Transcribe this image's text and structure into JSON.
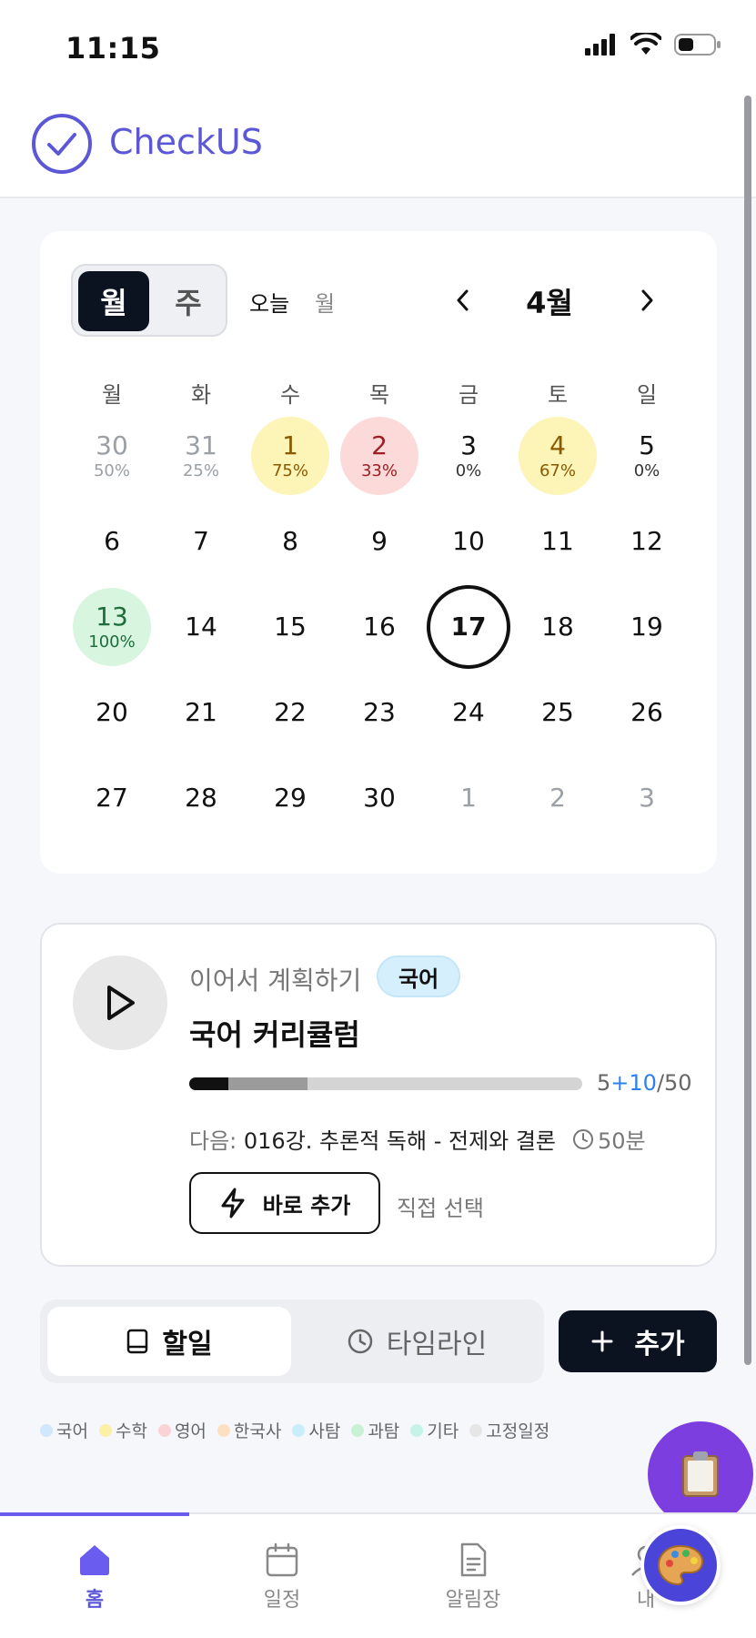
{
  "status_bar": {
    "time": "11:15"
  },
  "header": {
    "app_name": "CheckUS"
  },
  "calendar": {
    "view_toggle": {
      "month": "월",
      "week": "주"
    },
    "today_label": "오늘",
    "today_month_short": "월",
    "month_title": "4월",
    "weekdays": [
      "월",
      "화",
      "수",
      "목",
      "금",
      "토",
      "일"
    ],
    "rows": [
      [
        {
          "day": "30",
          "pct": "50%",
          "muted": true,
          "color": ""
        },
        {
          "day": "31",
          "pct": "25%",
          "muted": true,
          "color": ""
        },
        {
          "day": "1",
          "pct": "75%",
          "muted": false,
          "color": "yellow"
        },
        {
          "day": "2",
          "pct": "33%",
          "muted": false,
          "color": "red"
        },
        {
          "day": "3",
          "pct": "0%",
          "muted": false,
          "color": ""
        },
        {
          "day": "4",
          "pct": "67%",
          "muted": false,
          "color": "yellow"
        },
        {
          "day": "5",
          "pct": "0%",
          "muted": false,
          "color": ""
        }
      ],
      [
        {
          "day": "6"
        },
        {
          "day": "7"
        },
        {
          "day": "8"
        },
        {
          "day": "9"
        },
        {
          "day": "10"
        },
        {
          "day": "11"
        },
        {
          "day": "12"
        }
      ],
      [
        {
          "day": "13",
          "pct": "100%",
          "color": "green"
        },
        {
          "day": "14"
        },
        {
          "day": "15"
        },
        {
          "day": "16"
        },
        {
          "day": "17",
          "today": true
        },
        {
          "day": "18"
        },
        {
          "day": "19"
        }
      ],
      [
        {
          "day": "20"
        },
        {
          "day": "21"
        },
        {
          "day": "22"
        },
        {
          "day": "23"
        },
        {
          "day": "24"
        },
        {
          "day": "25"
        },
        {
          "day": "26"
        }
      ],
      [
        {
          "day": "27"
        },
        {
          "day": "28"
        },
        {
          "day": "29"
        },
        {
          "day": "30"
        },
        {
          "day": "1",
          "muted": true
        },
        {
          "day": "2",
          "muted": true
        },
        {
          "day": "3",
          "muted": true
        }
      ]
    ]
  },
  "plan": {
    "label": "이어서 계획하기",
    "subject": "국어",
    "title": "국어 커리큘럼",
    "progress": {
      "done": 5,
      "planned": 10,
      "total": 50,
      "done_text": "5",
      "plus_text": "+10",
      "total_text": "/50"
    },
    "next_prefix": "다음:",
    "next_lesson": "016강. 추론적 독해 - 전제와 결론",
    "duration": "50분",
    "quick_add": "바로 추가",
    "direct_select": "직접 선택"
  },
  "tasks": {
    "tab_todo": "할일",
    "tab_timeline": "타임라인",
    "add_label": "추가"
  },
  "legend": [
    {
      "label": "국어",
      "color": "#cfe8fb"
    },
    {
      "label": "수학",
      "color": "#fbf0a6"
    },
    {
      "label": "영어",
      "color": "#fbd3d6"
    },
    {
      "label": "한국사",
      "color": "#fde0c2"
    },
    {
      "label": "사탐",
      "color": "#c9eefa"
    },
    {
      "label": "과탐",
      "color": "#c9f2d4"
    },
    {
      "label": "기타",
      "color": "#c6f3e8"
    },
    {
      "label": "고정일정",
      "color": "#e6e6e6"
    }
  ],
  "bottom_nav": {
    "home": "홈",
    "schedule": "일정",
    "notice": "알림장",
    "my": "내"
  },
  "colors": {
    "accent": "#5b57d6",
    "dark": "#0b1220"
  }
}
